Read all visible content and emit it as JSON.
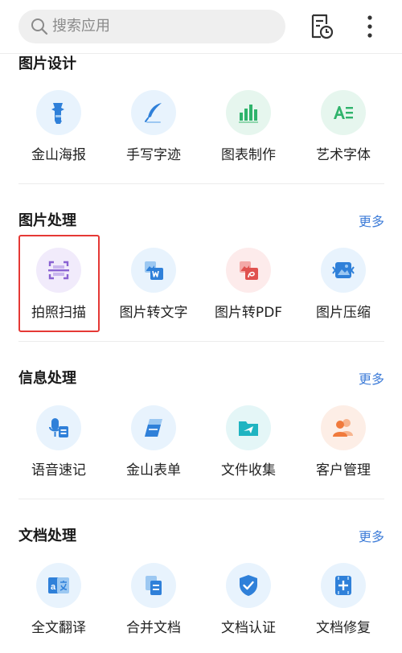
{
  "search": {
    "placeholder": "搜索应用",
    "icon": "search-icon"
  },
  "header_actions": {
    "history_icon": "document-clock-icon",
    "more_icon": "more-vertical-icon"
  },
  "sections": [
    {
      "title": "图片设计",
      "more": "",
      "items": [
        {
          "label": "金山海报",
          "icon": "poster-icon",
          "bg": "#e8f3fd",
          "color": "#2f80d9"
        },
        {
          "label": "手写字迹",
          "icon": "feather-pen-icon",
          "bg": "#e8f3fd",
          "color": "#2f80d9"
        },
        {
          "label": "图表制作",
          "icon": "bar-chart-icon",
          "bg": "#e6f6ee",
          "color": "#2fb36b"
        },
        {
          "label": "艺术字体",
          "icon": "art-font-icon",
          "bg": "#e6f6ee",
          "color": "#2fb36b"
        }
      ]
    },
    {
      "title": "图片处理",
      "more": "更多",
      "items": [
        {
          "label": "拍照扫描",
          "icon": "scan-icon",
          "bg": "#f1ebfb",
          "color": "#8a63d2"
        },
        {
          "label": "图片转文字",
          "icon": "image-to-word-icon",
          "bg": "#e8f3fd",
          "color": "#2f80d9"
        },
        {
          "label": "图片转PDF",
          "icon": "image-to-pdf-icon",
          "bg": "#fdebeb",
          "color": "#e0524f"
        },
        {
          "label": "图片压缩",
          "icon": "image-compress-icon",
          "bg": "#e8f3fd",
          "color": "#2f80d9"
        }
      ]
    },
    {
      "title": "信息处理",
      "more": "更多",
      "items": [
        {
          "label": "语音速记",
          "icon": "voice-note-icon",
          "bg": "#e8f3fd",
          "color": "#2f80d9"
        },
        {
          "label": "金山表单",
          "icon": "form-icon",
          "bg": "#e8f3fd",
          "color": "#2f80d9"
        },
        {
          "label": "文件收集",
          "icon": "file-collect-icon",
          "bg": "#e4f6f7",
          "color": "#1fb4c1"
        },
        {
          "label": "客户管理",
          "icon": "customer-icon",
          "bg": "#fdeee6",
          "color": "#f07a3c"
        }
      ]
    },
    {
      "title": "文档处理",
      "more": "更多",
      "items": [
        {
          "label": "全文翻译",
          "icon": "translate-icon",
          "bg": "#e8f3fd",
          "color": "#2f80d9"
        },
        {
          "label": "合并文档",
          "icon": "merge-docs-icon",
          "bg": "#e8f3fd",
          "color": "#2f80d9"
        },
        {
          "label": "文档认证",
          "icon": "shield-check-icon",
          "bg": "#e8f3fd",
          "color": "#2f80d9"
        },
        {
          "label": "文档修复",
          "icon": "doc-repair-icon",
          "bg": "#e8f3fd",
          "color": "#2f80d9"
        }
      ]
    }
  ],
  "highlight_color": "#e53935"
}
